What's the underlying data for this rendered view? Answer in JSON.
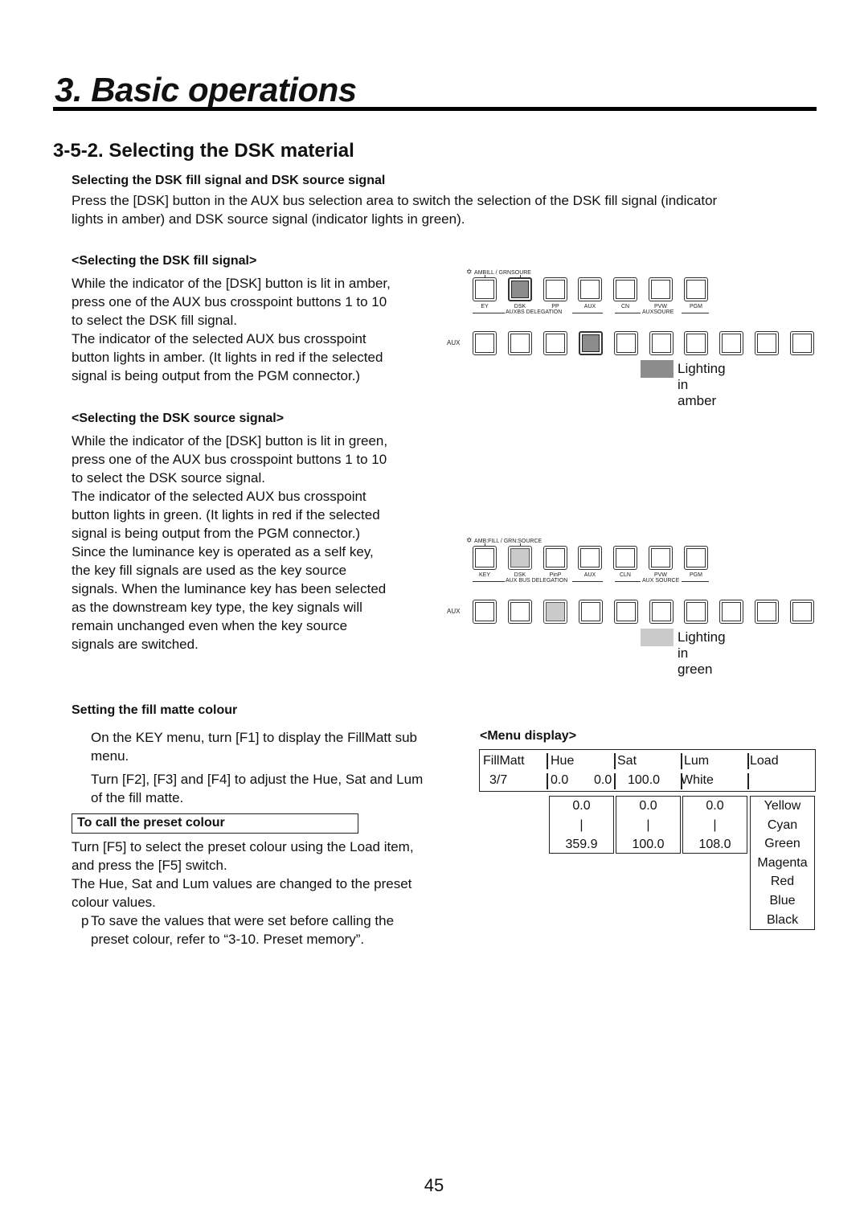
{
  "chapter": {
    "title": "3. Basic operations"
  },
  "section": {
    "title": "3-5-2. Selecting the DSK material"
  },
  "intro": {
    "heading": "Selecting the DSK fill signal and DSK source signal",
    "lines": [
      "Press the [DSK] button in the AUX bus selection area to switch the selection of the DSK fill signal (indicator",
      "lights in amber) and DSK source signal (indicator lights in green)."
    ]
  },
  "fill_signal": {
    "heading": "<Selecting the DSK fill signal>",
    "lines": [
      "While the indicator of the [DSK] button is lit in amber,",
      "press one of the AUX bus crosspoint buttons 1 to 10",
      "to select the DSK fill signal.",
      "The indicator of the selected AUX bus crosspoint",
      "button lights in amber. (It lights in red if the selected",
      "signal is being output from the PGM connector.)"
    ]
  },
  "source_signal": {
    "heading": "<Selecting the DSK source signal>",
    "lines": [
      "While the indicator of the [DSK] button is lit in green,",
      "press one of the AUX bus crosspoint buttons 1 to 10",
      "to select the DSK source signal.",
      "The indicator of the selected AUX bus crosspoint",
      "button lights in green. (It lights in red if the selected",
      "signal is being output from the PGM connector.)",
      "Since the luminance key is operated as a self key,",
      "the key fill signals are used as the key source",
      "signals. When the luminance key has been selected",
      "as the downstream key type, the key signals will",
      "remain unchanged even when the key source",
      "signals are switched."
    ]
  },
  "panel_amber": {
    "legend": "AMBILL / GRNSOURE",
    "legend_icon": "indicator-icon",
    "buttons": [
      {
        "label": "EY",
        "state": "off"
      },
      {
        "label": "DSK",
        "state": "amber"
      },
      {
        "label": "PP",
        "state": "off"
      },
      {
        "label": "AUX",
        "state": "off"
      },
      {
        "label": "CN",
        "state": "off"
      },
      {
        "label": "PVW",
        "state": "off"
      },
      {
        "label": "PGM",
        "state": "off"
      }
    ],
    "group_left": "AUXBS DELEGATION",
    "group_right": "AUXSOURE",
    "aux_row_label": "AUX",
    "aux_selected_index": 4,
    "aux_button_count": 10,
    "swatch_label": "Lighting in amber"
  },
  "panel_green": {
    "legend": "AMB:FILL / GRN:SOURCE",
    "legend_icon": "indicator-icon",
    "buttons": [
      {
        "label": "KEY",
        "state": "off"
      },
      {
        "label": "DSK",
        "state": "green"
      },
      {
        "label": "PinP",
        "state": "off"
      },
      {
        "label": "AUX",
        "state": "off"
      },
      {
        "label": "CLN",
        "state": "off"
      },
      {
        "label": "PVW",
        "state": "off"
      },
      {
        "label": "PGM",
        "state": "off"
      }
    ],
    "group_left": "AUX BUS DELEGATION",
    "group_right": "AUX SOURCE",
    "aux_row_label": "AUX",
    "aux_selected_index": 3,
    "aux_button_count": 10,
    "swatch_label": "Lighting in green"
  },
  "colors": {
    "amber_indicator": "#8c8c8c",
    "green_indicator": "#cacaca"
  },
  "fill_matte": {
    "heading": "Setting the fill matte colour",
    "para1": [
      "On the KEY menu, turn [F1] to display the FillMatt sub",
      "menu."
    ],
    "para2": [
      "Turn [F2], [F3] and [F4] to adjust the Hue, Sat and Lum",
      "of the fill matte."
    ],
    "callout": "To call the preset colour",
    "para3": [
      "Turn [F5] to select the preset colour using the Load item,",
      "and press the [F5] switch.",
      "The Hue, Sat and Lum values are changed to the preset",
      "colour values."
    ],
    "note_marker": "p",
    "note": [
      "To save the values that were set before calling the",
      "preset colour, refer to “3-10. Preset memory”."
    ]
  },
  "menu_display": {
    "heading": "<Menu display>",
    "row1": [
      "FillMatt",
      "Hue",
      "Sat",
      "Lum",
      "Load"
    ],
    "row2": [
      "3/7",
      "0.0",
      "0.0",
      "100.0",
      "White",
      ""
    ],
    "ranges": [
      {
        "min": "0.0",
        "sep": "|",
        "max": "359.9"
      },
      {
        "min": "0.0",
        "sep": "|",
        "max": "100.0"
      },
      {
        "min": "0.0",
        "sep": "|",
        "max": "108.0"
      }
    ],
    "presets": [
      "Yellow",
      "Cyan",
      "Green",
      "Magenta",
      "Red",
      "Blue",
      "Black"
    ]
  },
  "page_number": "45"
}
